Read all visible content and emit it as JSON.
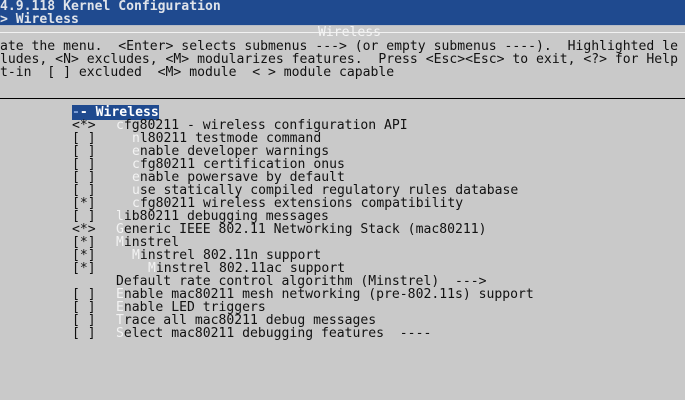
{
  "header": {
    "title": "4.9.118 Kernel Configuration",
    "breadcrumb": "> Wireless"
  },
  "box": {
    "title": "Wireless"
  },
  "help": [
    "ate the menu.  <Enter> selects submenus ---> (or empty submenus ----).  Highlighted le",
    "ludes, <N> excludes, <M> modularizes features.  Press <Esc><Esc> to exit, <?> for Help",
    "t-in  [ ] excluded  <M> module  < > module capable"
  ],
  "items": [
    {
      "mark": "",
      "indent": 0,
      "hotkey": "-",
      "text": "- Wireless",
      "selected": true
    },
    {
      "mark": "<*>",
      "indent": 0,
      "hotkey": "c",
      "text": "fg80211 - wireless configuration API"
    },
    {
      "mark": "[ ]",
      "indent": 1,
      "hotkey": "n",
      "text": "l80211 testmode command"
    },
    {
      "mark": "[ ]",
      "indent": 1,
      "hotkey": "e",
      "text": "nable developer warnings"
    },
    {
      "mark": "[ ]",
      "indent": 1,
      "hotkey": "c",
      "text": "fg80211 certification onus"
    },
    {
      "mark": "[ ]",
      "indent": 1,
      "hotkey": "e",
      "text": "nable powersave by default"
    },
    {
      "mark": "[ ]",
      "indent": 1,
      "hotkey": "u",
      "text": "se statically compiled regulatory rules database"
    },
    {
      "mark": "[*]",
      "indent": 1,
      "hotkey": "c",
      "text": "fg80211 wireless extensions compatibility"
    },
    {
      "mark": "[ ]",
      "indent": 0,
      "hotkey": "l",
      "text": "ib80211 debugging messages"
    },
    {
      "mark": "<*>",
      "indent": 0,
      "hotkey": "G",
      "text": "eneric IEEE 802.11 Networking Stack (mac80211)"
    },
    {
      "mark": "[*]",
      "indent": 0,
      "hotkey": "M",
      "text": "instrel"
    },
    {
      "mark": "[*]",
      "indent": 1,
      "hotkey": "M",
      "text": "instrel 802.11n support"
    },
    {
      "mark": "[*]",
      "indent": 2,
      "hotkey": "M",
      "text": "instrel 802.11ac support"
    },
    {
      "mark": "",
      "indent": 0,
      "hotkey": "",
      "text": "Default rate control algorithm (Minstrel)  --->"
    },
    {
      "mark": "[ ]",
      "indent": 0,
      "hotkey": "E",
      "text": "nable mac80211 mesh networking (pre-802.11s) support"
    },
    {
      "mark": "[ ]",
      "indent": 0,
      "hotkey": "E",
      "text": "nable LED triggers"
    },
    {
      "mark": "[ ]",
      "indent": 0,
      "hotkey": "T",
      "text": "race all mac80211 debug messages"
    },
    {
      "mark": "[ ]",
      "indent": 0,
      "hotkey": "S",
      "text": "elect mac80211 debugging features  ----"
    }
  ]
}
